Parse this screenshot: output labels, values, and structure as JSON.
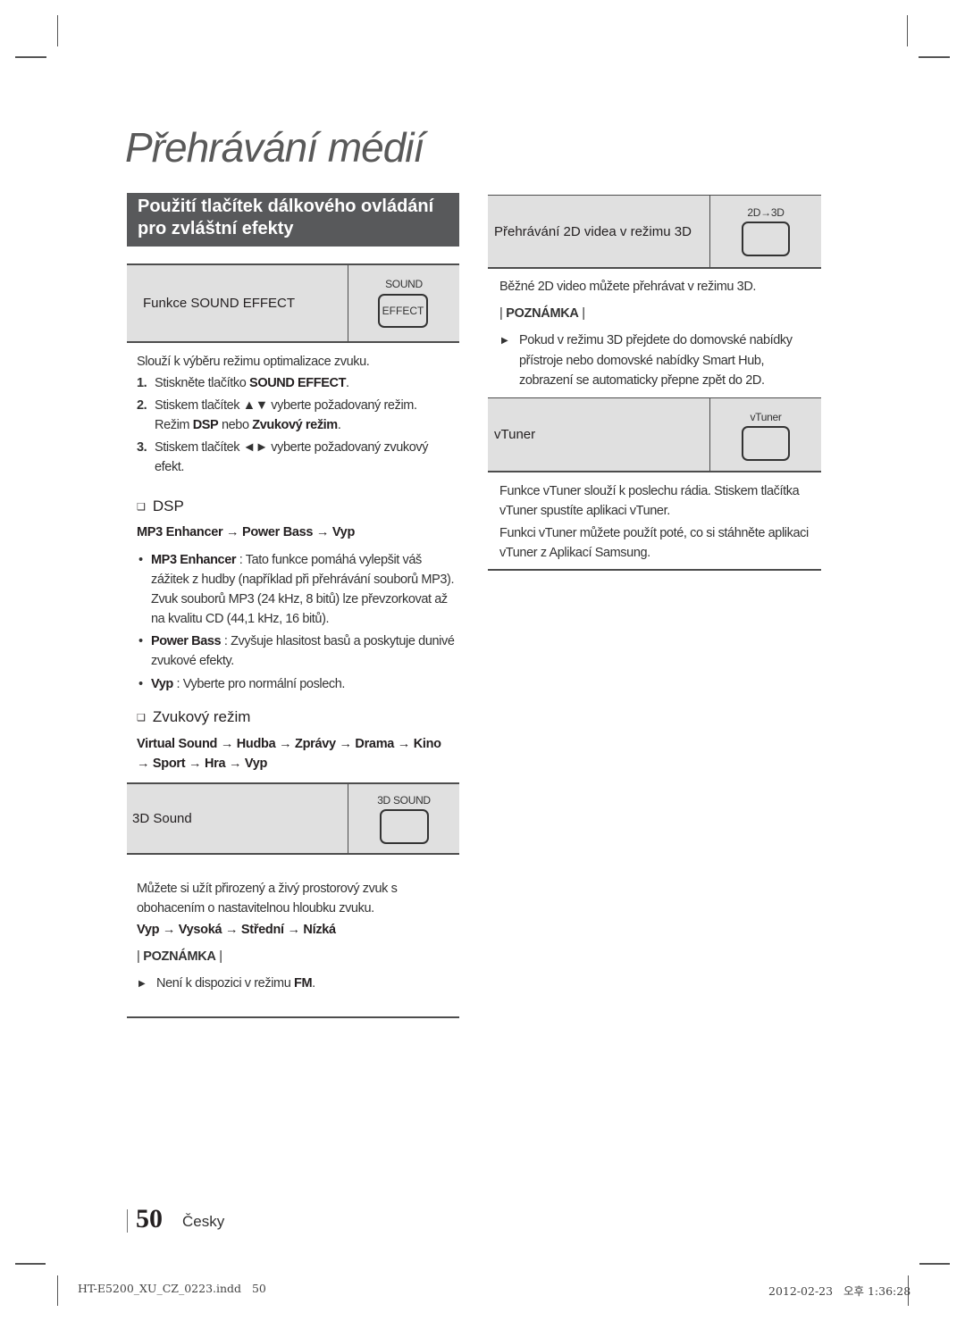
{
  "page": {
    "title": "Přehrávání médií",
    "section_header": [
      "Použití tlačítek dálkového ovládání",
      "pro zvláštní efekty"
    ]
  },
  "left_column": {
    "sound_effect": {
      "label": "Funkce SOUND EFFECT",
      "button_caption": "SOUND",
      "button_text": "EFFECT",
      "intro": "Slouží k výběru režimu optimalizace zvuku.",
      "steps": [
        {
          "num": "1.",
          "pre": "Stiskněte tlačítko ",
          "bold": "SOUND EFFECT",
          "post": "."
        },
        {
          "num": "2.",
          "line1": "Stiskem tlačítek ▲▼ vyberte požadovaný režim.",
          "line2_pre": "Režim ",
          "line2_b1": "DSP",
          "line2_mid": " nebo ",
          "line2_b2": "Zvukový režim",
          "line2_post": "."
        },
        {
          "num": "3.",
          "line1": "Stiskem tlačítek ◄► vyberte požadovaný zvukový",
          "line2": "efekt."
        }
      ]
    },
    "dsp": {
      "heading": "DSP",
      "sequence": "MP3 Enhancer → Power Bass → Vyp",
      "bullets": [
        {
          "term": "MP3 Enhancer",
          "lines": [
            " : Tato funkce pomáhá vylepšit váš",
            "zážitek z hudby (například při přehrávání souborů MP3).",
            "Zvuk souborů MP3 (24 kHz, 8 bitů) lze převzorkovat až",
            "na kvalitu CD (44,1 kHz, 16 bitů)."
          ]
        },
        {
          "term": "Power Bass",
          "lines": [
            " : Zvyšuje hlasitost basů a poskytuje dunivé",
            "zvukové efekty."
          ]
        },
        {
          "term": "Vyp",
          "lines": [
            " : Vyberte pro normální poslech."
          ]
        }
      ]
    },
    "sound_mode": {
      "heading": "Zvukový režim",
      "sequence_line1": "Virtual Sound → Hudba → Zprávy → Drama → Kino",
      "sequence_line2": "→ Sport → Hra → Vyp"
    },
    "sound_3d": {
      "label": "3D Sound",
      "button_caption": "3D SOUND",
      "desc_line1": "Můžete si užít přirozený a živý prostorový zvuk s",
      "desc_line2": "obohacením o nastavitelnou hloubku zvuku.",
      "sequence": "Vyp → Vysoká → Střední → Nízká",
      "note_label": "POZNÁMKA",
      "note_pre": "Není k dispozici v režimu ",
      "note_bold": "FM",
      "note_post": "."
    }
  },
  "right_column": {
    "video_2d3d": {
      "label": "Přehrávání 2D videa v režimu 3D",
      "button_caption": "2D→3D",
      "desc": "Běžné 2D video můžete přehrávat v režimu 3D.",
      "note_label": "POZNÁMKA",
      "note_lines": [
        "Pokud v režimu 3D přejdete do domovské nabídky",
        "přístroje nebo domovské nabídky Smart Hub,",
        "zobrazení se automaticky přepne zpět do 2D."
      ]
    },
    "vtuner": {
      "label": "vTuner",
      "button_caption": "vTuner",
      "desc_lines": [
        "Funkce vTuner slouží k poslechu rádia. Stiskem tlačítka",
        "vTuner spustíte aplikaci vTuner.",
        "Funkci vTuner můžete použít poté, co si stáhněte aplikaci",
        "vTuner z Aplikací Samsung."
      ]
    }
  },
  "footer": {
    "page_number": "50",
    "language": "Česky",
    "slug_file": "HT-E5200_XU_CZ_0223.indd   50",
    "slug_date": "2012-02-23   오후 1:36:28"
  }
}
